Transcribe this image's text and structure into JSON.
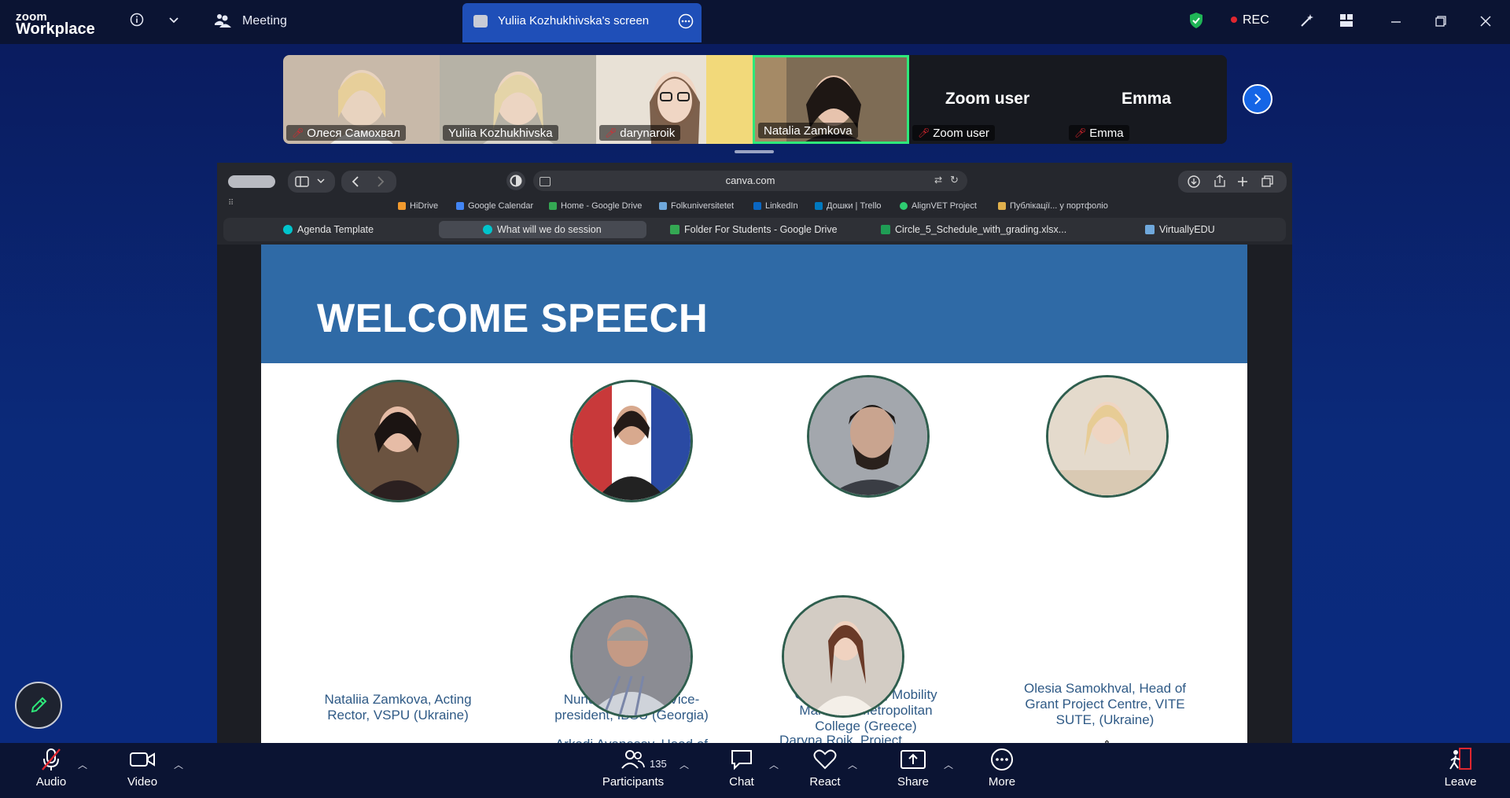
{
  "app": {
    "logo_top": "zoom",
    "logo_bottom": "Workplace",
    "meeting_label": "Meeting",
    "screen_tab_label": "Yuliia Kozhukhivska's screen",
    "rec_label": "REC"
  },
  "participants": [
    {
      "name": "Олеся Самохвал",
      "muted": true,
      "bg": "#c8b9a9"
    },
    {
      "name": "Yuliia Kozhukhivska",
      "muted": false,
      "bg": "#b6b2a6"
    },
    {
      "name": "darynaroik",
      "muted": true,
      "bg": "#d9cfc0"
    },
    {
      "name": "Natalia Zamkova",
      "muted": false,
      "bg": "#7e6c55",
      "active": true
    },
    {
      "name": "Zoom user",
      "muted": true,
      "big": "Zoom user"
    },
    {
      "name": "Emma",
      "muted": true,
      "big": "Emma"
    }
  ],
  "browser": {
    "url": "canva.com",
    "bookmarks": [
      {
        "label": "HiDrive",
        "color": "#f29a2e"
      },
      {
        "label": "Google Calendar",
        "color": "#4285f4"
      },
      {
        "label": "Home - Google Drive",
        "color": "#34a853"
      },
      {
        "label": "Folkuniversitetet",
        "color": "#6fa8dc"
      },
      {
        "label": "LinkedIn",
        "color": "#0a66c2"
      },
      {
        "label": "Дошки | Trello",
        "color": "#0079bf"
      },
      {
        "label": "AlignVET Project",
        "color": "#2ecc71"
      },
      {
        "label": "Публікації... у портфоліо",
        "color": "#e0b04c"
      }
    ],
    "tabs": [
      {
        "label": "Agenda Template",
        "color": "#00c4cc"
      },
      {
        "label": "What will we do session",
        "color": "#00c4cc",
        "active": true
      },
      {
        "label": "Folder For Students - Google Drive",
        "color": "#34a853"
      },
      {
        "label": "Circle_5_Schedule_with_grading.xlsx...",
        "color": "#1f9d55"
      },
      {
        "label": "VirtuallyEDU",
        "color": "#6fa8dc"
      }
    ]
  },
  "slide": {
    "title": "WELCOME SPEECH",
    "speakers": [
      {
        "caption": "Nataliia Zamkova, Acting Rector, VSPU (Ukraine)",
        "bg": "#5a4332"
      },
      {
        "caption": "Nunu Mitskevich, Vice-president, IBSU (Georgia)",
        "bg": "#b9524f"
      },
      {
        "caption": "Christos Nistas, Mobility Manager, Metropolitan College (Greece)",
        "bg": "#9a9ea3"
      },
      {
        "caption": "Olesia Samokhval, Head of Grant Project Centre, VITE SUTE, (Ukraine)",
        "bg": "#d8cdbd"
      },
      {
        "caption": "Arkadi Avanesov, Head of",
        "bg": "#8b8c93"
      },
      {
        "caption": "Daryna Roik, Project",
        "bg": "#c9c1b8"
      }
    ]
  },
  "toolbar": {
    "audio": "Audio",
    "video": "Video",
    "participants": "Participants",
    "participants_count": "135",
    "chat": "Chat",
    "react": "React",
    "share": "Share",
    "more": "More",
    "leave": "Leave"
  },
  "colors": {
    "accent": "#1565e6",
    "slide_header": "#2f6aa6",
    "caption_text": "#2f5a86",
    "active_tile_border": "#2ee87a"
  }
}
